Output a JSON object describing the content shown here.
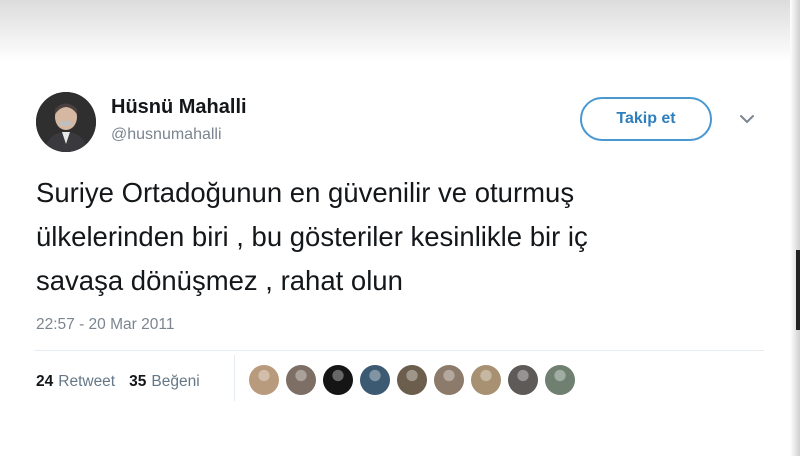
{
  "tweet": {
    "author_name": "Hüsnü Mahalli",
    "author_handle": "@husnumahalli",
    "follow_label": "Takip et",
    "text": "Suriye Ortadoğunun en güvenilir ve oturmuş\nülkelerinden biri , bu gösteriler kesinlikle bir iç\nsavaşa dönüşmez , rahat olun",
    "timestamp": "22:57 - 20 Mar 2011"
  },
  "stats": {
    "retweet_count": "24",
    "retweet_label": "Retweet",
    "like_count": "35",
    "like_label": "Beğeni"
  },
  "icons": {
    "more": "chevron-down-icon"
  },
  "liker_avatars": [
    {
      "color": "#b89a7c"
    },
    {
      "color": "#7d6f66"
    },
    {
      "color": "#151515"
    },
    {
      "color": "#3d5a73"
    },
    {
      "color": "#6b5e4c"
    },
    {
      "color": "#8c7a6a"
    },
    {
      "color": "#a89172"
    },
    {
      "color": "#5d5a58"
    },
    {
      "color": "#6f8070"
    }
  ]
}
